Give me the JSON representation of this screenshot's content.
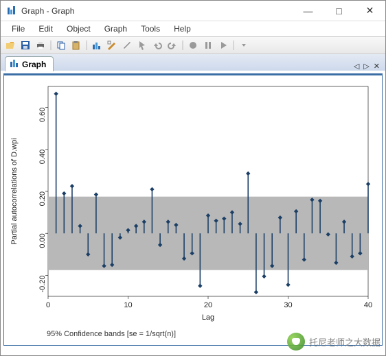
{
  "window": {
    "title": "Graph - Graph",
    "min": "—",
    "max": "□",
    "close": "✕"
  },
  "menu": {
    "file": "File",
    "edit": "Edit",
    "object": "Object",
    "graph": "Graph",
    "tools": "Tools",
    "help": "Help"
  },
  "tab": {
    "label": "Graph"
  },
  "tabnav": {
    "left": "◁",
    "right": "▷",
    "close": "✕"
  },
  "chart_data": {
    "type": "bar",
    "title": "",
    "xlabel": "Lag",
    "ylabel": "Partial autocorrelations of D.wpi",
    "xlim": [
      0,
      40
    ],
    "ylim": [
      -0.3,
      0.7
    ],
    "xticks": [
      0,
      10,
      20,
      30,
      40
    ],
    "yticks": [
      -0.2,
      0.0,
      0.2,
      0.4,
      0.6
    ],
    "band": {
      "low": -0.175,
      "high": 0.175
    },
    "categories": [
      1,
      2,
      3,
      4,
      5,
      6,
      7,
      8,
      9,
      10,
      11,
      12,
      13,
      14,
      15,
      16,
      17,
      18,
      19,
      20,
      21,
      22,
      23,
      24,
      25,
      26,
      27,
      28,
      29,
      30,
      31,
      32,
      33,
      34,
      35,
      36,
      37,
      38,
      39,
      40
    ],
    "values": [
      0.665,
      0.19,
      0.225,
      0.035,
      -0.1,
      0.185,
      -0.155,
      -0.15,
      -0.02,
      0.015,
      0.035,
      0.055,
      0.21,
      -0.055,
      0.055,
      0.04,
      -0.12,
      -0.095,
      -0.25,
      0.085,
      0.06,
      0.07,
      0.1,
      0.045,
      0.285,
      -0.28,
      -0.205,
      -0.155,
      0.075,
      -0.245,
      0.105,
      -0.125,
      0.16,
      0.155,
      -0.005,
      -0.14,
      0.055,
      -0.11,
      -0.095,
      0.235
    ],
    "footnote": "95% Confidence bands [se = 1/sqrt(n)]"
  },
  "watermark": {
    "text": "托尼老师之大数据"
  }
}
